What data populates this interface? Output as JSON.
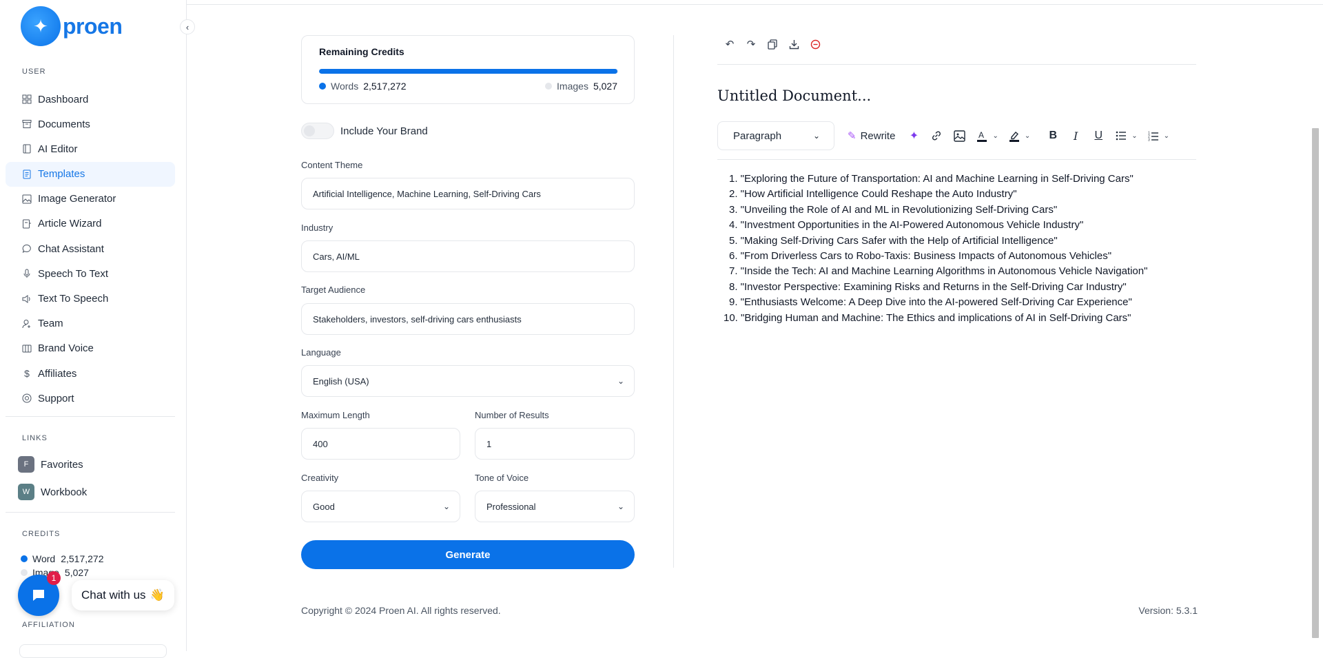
{
  "app": {
    "brand": "proen"
  },
  "sidebar": {
    "section_user": "USER",
    "items": [
      {
        "label": "Dashboard",
        "icon": "grid-icon",
        "active": false
      },
      {
        "label": "Documents",
        "icon": "archive-icon",
        "active": false
      },
      {
        "label": "AI Editor",
        "icon": "book-icon",
        "active": false
      },
      {
        "label": "Templates",
        "icon": "file-text-icon",
        "active": true
      },
      {
        "label": "Image Generator",
        "icon": "image-icon",
        "active": false
      },
      {
        "label": "Article Wizard",
        "icon": "file-edit-icon",
        "active": false
      },
      {
        "label": "Chat Assistant",
        "icon": "message-icon",
        "active": false
      },
      {
        "label": "Speech To Text",
        "icon": "mic-icon",
        "active": false
      },
      {
        "label": "Text To Speech",
        "icon": "speaker-icon",
        "active": false
      },
      {
        "label": "Team",
        "icon": "user-icon",
        "active": false
      },
      {
        "label": "Brand Voice",
        "icon": "book-open-icon",
        "active": false
      },
      {
        "label": "Affiliates",
        "icon": "dollar-icon",
        "active": false
      },
      {
        "label": "Support",
        "icon": "lifebuoy-icon",
        "active": false
      }
    ],
    "section_links": "LINKS",
    "links": [
      {
        "badge": "F",
        "label": "Favorites",
        "color": "#6b7280"
      },
      {
        "badge": "W",
        "label": "Workbook",
        "color": "#5b7f86"
      }
    ],
    "section_credits": "CREDITS",
    "credits": {
      "word_label": "Word",
      "word_value": "2,517,272",
      "image_label": "Image",
      "image_value": "5,027"
    },
    "section_affiliation": "AFFILIATION"
  },
  "chat_widget": {
    "label": "Chat with us",
    "emoji": "👋",
    "badge_count": "1"
  },
  "credits_card": {
    "title": "Remaining Credits",
    "progress": 0.998,
    "words_label": "Words",
    "words_value": "2,517,272",
    "images_label": "Images",
    "images_value": "5,027"
  },
  "form": {
    "brand_toggle_label": "Include Your Brand",
    "brand_toggle_on": false,
    "content_theme_label": "Content Theme",
    "content_theme_value": "Artificial Intelligence, Machine Learning, Self-Driving Cars",
    "industry_label": "Industry",
    "industry_value": "Cars, AI/ML",
    "audience_label": "Target Audience",
    "audience_value": "Stakeholders, investors, self-driving cars enthusiasts",
    "language_label": "Language",
    "language_value": "English (USA)",
    "max_length_label": "Maximum Length",
    "max_length_value": "400",
    "num_results_label": "Number of Results",
    "num_results_value": "1",
    "creativity_label": "Creativity",
    "creativity_value": "Good",
    "tone_label": "Tone of Voice",
    "tone_value": "Professional",
    "generate_label": "Generate"
  },
  "editor": {
    "title": "Untitled Document...",
    "paragraph_select": "Paragraph",
    "rewrite_label": "Rewrite",
    "lines": [
      "1. \"Exploring the Future of Transportation: AI and Machine Learning in Self-Driving Cars\"",
      "2. \"How Artificial Intelligence Could Reshape the Auto Industry\"",
      "3. \"Unveiling the Role of AI and ML in Revolutionizing Self-Driving Cars\"",
      "4. \"Investment Opportunities in the AI-Powered Autonomous Vehicle Industry\"",
      "5. \"Making Self-Driving Cars Safer with the Help of Artificial Intelligence\"",
      "6. \"From Driverless Cars to Robo-Taxis: Business Impacts of Autonomous Vehicles\"",
      "7. \"Inside the Tech: AI and Machine Learning Algorithms in Autonomous Vehicle Navigation\"",
      "8. \"Investor Perspective: Examining Risks and Returns in the Self-Driving Car Industry\"",
      "9. \"Enthusiasts Welcome: A Deep Dive into the AI-powered Self-Driving Car Experience\"",
      "10. \"Bridging Human and Machine: The Ethics and implications of AI in Self-Driving Cars\""
    ]
  },
  "footer": {
    "copyright": "Copyright © 2024 Proen AI. All rights reserved.",
    "version": "Version: 5.3.1"
  },
  "colors": {
    "accent": "#0a72e8",
    "active_bg": "#f0f6ff"
  }
}
